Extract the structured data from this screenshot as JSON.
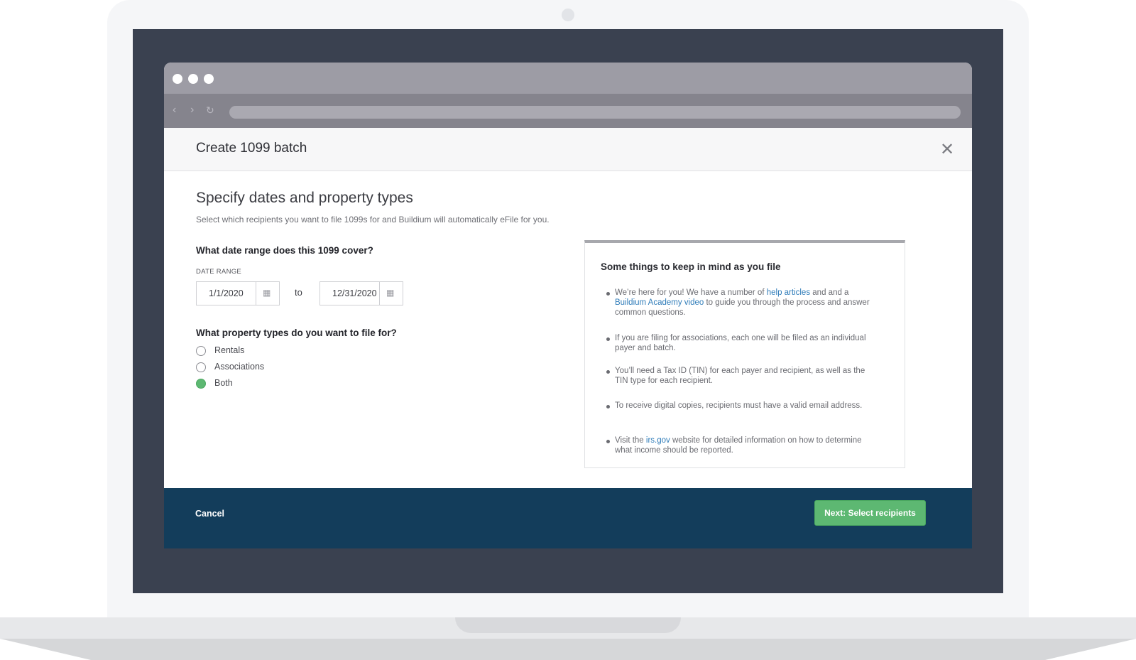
{
  "modal": {
    "title": "Create 1099 batch",
    "close_glyph": "✕"
  },
  "section": {
    "title": "Specify dates and property types",
    "description": "Select which recipients you want to file 1099s for and Buildium will automatically eFile for you."
  },
  "date_question": {
    "label": "What date range does this 1099 cover?",
    "range_label": "DATE RANGE",
    "start_value": "1/1/2020",
    "end_value": "12/31/2020",
    "to_label": "to"
  },
  "property_question": {
    "label": "What property types do you want to file for?",
    "options": [
      {
        "label": "Rentals",
        "checked": false
      },
      {
        "label": "Associations",
        "checked": false
      },
      {
        "label": "Both",
        "checked": true
      }
    ]
  },
  "info": {
    "title": "Some things to keep in mind as you file",
    "bullets": {
      "b1": {
        "pre": "We’re here for you! We have a number of ",
        "link1": "help articles",
        "mid": " and and a ",
        "link2": "Buildium Academy video",
        "post": " to guide you through the process and answer common questions."
      },
      "b2": "If you are filing for associations, each one will be filed as an individual payer and batch.",
      "b3": "You’ll need a Tax ID (TIN) for each payer and recipient, as well as the TIN type for each recipient.",
      "b4": "To receive digital copies, recipients must have a valid email address.",
      "b5": {
        "pre": "Visit the ",
        "link": "irs.gov",
        "post": " website for detailed information on how to determine what income should be reported."
      }
    }
  },
  "footer": {
    "cancel_label": "Cancel",
    "next_label": "Next: Select recipients"
  },
  "icons": {
    "calendar": "calendar-icon",
    "close": "close-icon",
    "back": "back-arrow-icon",
    "forward": "forward-arrow-icon",
    "reload": "reload-icon"
  },
  "colors": {
    "accent_green": "#5db872",
    "footer_navy": "#133d5b",
    "link_blue": "#2f7cb9"
  }
}
